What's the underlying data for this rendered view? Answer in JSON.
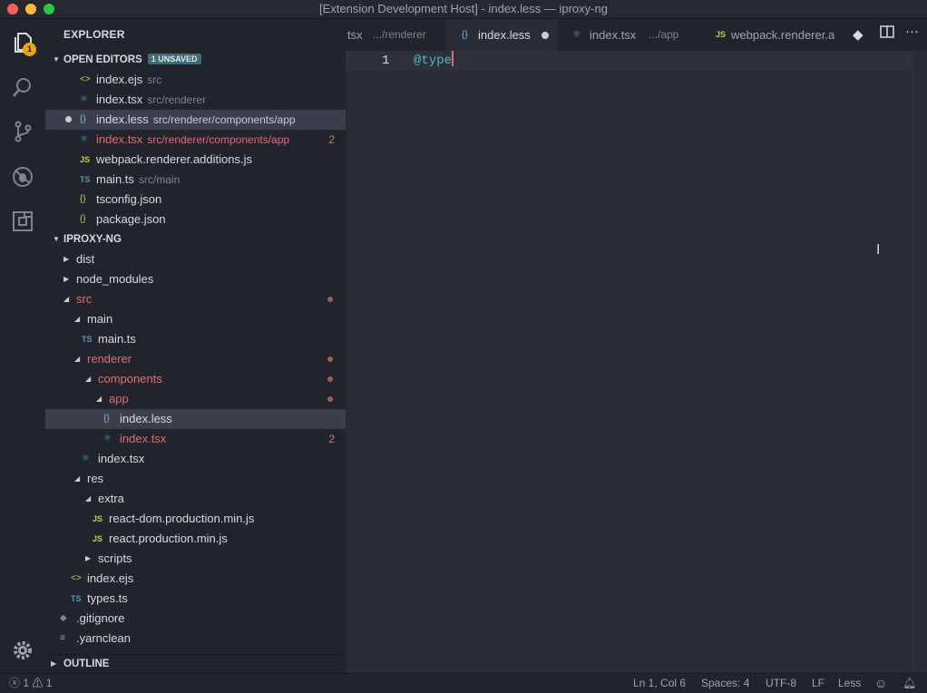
{
  "window": {
    "title": "[Extension Development Host] - index.less — iproxy-ng"
  },
  "activity": {
    "explorer_badge": "1"
  },
  "sidebar": {
    "title": "EXPLORER",
    "open_editors": {
      "label": "OPEN EDITORS",
      "unsaved_badge": "1 UNSAVED",
      "items": [
        {
          "name": "index.ejs",
          "desc": "src",
          "icon": "ejs-icon"
        },
        {
          "name": "index.tsx",
          "desc": "src/renderer",
          "icon": "react-icon"
        },
        {
          "name": "index.less",
          "desc": "src/renderer/components/app",
          "icon": "less-icon"
        },
        {
          "name": "index.tsx",
          "desc": "src/renderer/components/app",
          "icon": "react-icon",
          "count": "2"
        },
        {
          "name": "webpack.renderer.additions.js",
          "desc": "",
          "icon": "js-icon"
        },
        {
          "name": "main.ts",
          "desc": "src/main",
          "icon": "ts-icon"
        },
        {
          "name": "tsconfig.json",
          "desc": "",
          "icon": "json-icon"
        },
        {
          "name": "package.json",
          "desc": "",
          "icon": "json-icon"
        }
      ]
    },
    "project": {
      "label": "IPROXY-NG",
      "items": [
        {
          "name": "dist"
        },
        {
          "name": "node_modules"
        },
        {
          "name": "src"
        },
        {
          "name": "main"
        },
        {
          "name": "main.ts"
        },
        {
          "name": "renderer"
        },
        {
          "name": "components"
        },
        {
          "name": "app"
        },
        {
          "name": "index.less"
        },
        {
          "name": "index.tsx",
          "count": "2"
        },
        {
          "name": "index.tsx"
        },
        {
          "name": "res"
        },
        {
          "name": "extra"
        },
        {
          "name": "react-dom.production.min.js"
        },
        {
          "name": "react.production.min.js"
        },
        {
          "name": "scripts"
        },
        {
          "name": "index.ejs"
        },
        {
          "name": "types.ts"
        },
        {
          "name": ".gitignore"
        },
        {
          "name": ".yarnclean"
        }
      ]
    },
    "outline_label": "OUTLINE"
  },
  "tabs": [
    {
      "name": "tsx",
      "path": ".../renderer"
    },
    {
      "name": "index.less",
      "path": ""
    },
    {
      "name": "index.tsx",
      "path": ".../app"
    },
    {
      "name": "webpack.renderer.a",
      "path": ""
    }
  ],
  "editor": {
    "line_number": "1",
    "code": "@type"
  },
  "status": {
    "errors": "1",
    "warnings": "1",
    "position": "Ln 1, Col 6",
    "spaces": "Spaces: 4",
    "encoding": "UTF-8",
    "eol": "LF",
    "language": "Less"
  }
}
